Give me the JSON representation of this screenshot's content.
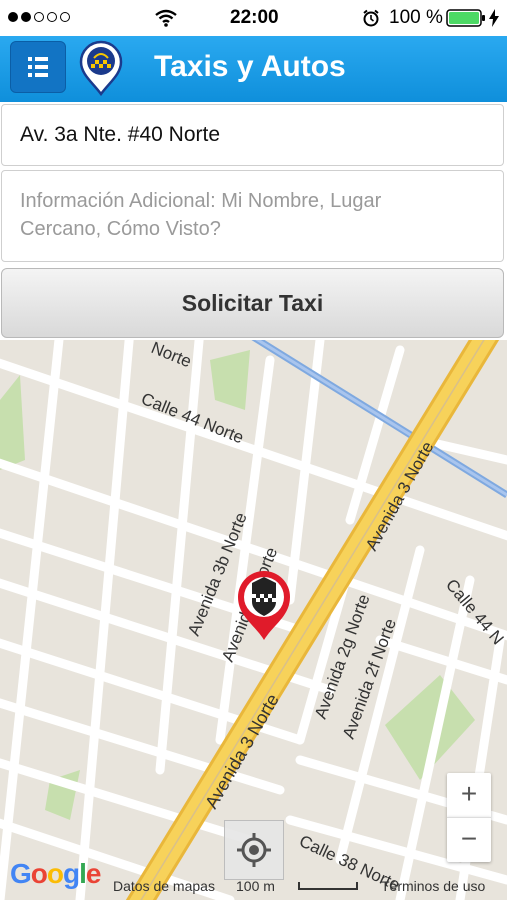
{
  "status_bar": {
    "time": "22:00",
    "battery": "100 %",
    "signal_dots": [
      true,
      true,
      false,
      false,
      false
    ]
  },
  "navbar": {
    "title": "Taxis y Autos",
    "menu_icon": "list-icon",
    "logo_icon": "taxi-pin-logo-icon",
    "color": "#1a9be6"
  },
  "form": {
    "address_value": "Av. 3a Nte. #40 Norte",
    "info_line1": "Información Adicional: Mi Nombre, Lugar",
    "info_line2": "Cercano, Cómo Visto?",
    "submit_label": "Solicitar Taxi"
  },
  "map": {
    "street_labels": [
      "Norte",
      "Calle 44 Norte",
      "Avenida 3 Norte",
      "Avenida 3b Norte",
      "Avenida 3 Norte",
      "Avenida 2g Norte",
      "Avenida 2f Norte",
      "Calle 44 N",
      "Avenida 3 Norte",
      "Calle 38 Norte"
    ],
    "zoom_in": "+",
    "zoom_out": "−",
    "locate_icon": "crosshair-icon",
    "marker_icon": "taxi-marker-icon",
    "footer": {
      "brand": "Google",
      "map_data": "Datos de mapas",
      "scale": "100 m",
      "terms": "Términos de uso"
    }
  }
}
